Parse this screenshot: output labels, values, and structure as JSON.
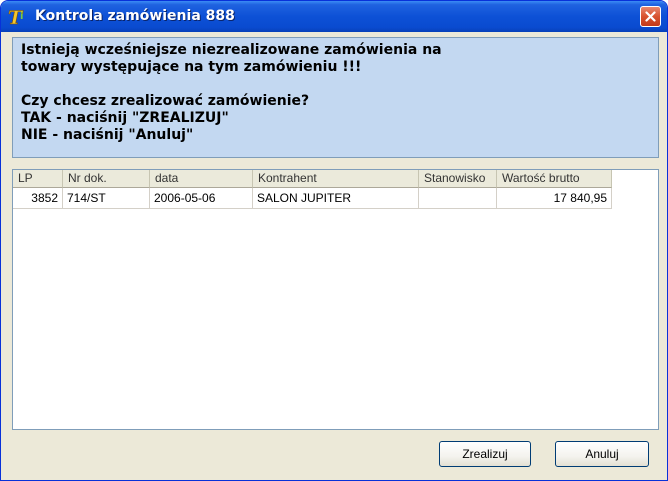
{
  "window": {
    "title": "Kontrola zamówienia 888",
    "app_icon": "t-logo-icon",
    "close_icon": "close-icon"
  },
  "message": {
    "lines": [
      "Istnieją wcześniejsze niezrealizowane zamówienia na",
      "towary występujące na tym zamówieniu !!!",
      "",
      "Czy chcesz zrealizować zamówienie?",
      "TAK - naciśnij \"ZREALIZUJ\"",
      "NIE - naciśnij \"Anuluj\""
    ]
  },
  "table": {
    "columns": [
      "LP",
      "Nr dok.",
      "data",
      "Kontrahent",
      "Stanowisko",
      "Wartość brutto"
    ],
    "rows": [
      [
        "3852",
        "714/ST",
        "2006-05-06",
        "SALON JUPITER",
        "",
        "17 840,95"
      ]
    ]
  },
  "buttons": {
    "realize": "Zrealizuj",
    "cancel": "Anuluj"
  },
  "colors": {
    "title_bar": "#0a4bd0",
    "message_background": "#c3d8f1",
    "dialog_background": "#ece9d8",
    "close_button": "#d8532f"
  }
}
